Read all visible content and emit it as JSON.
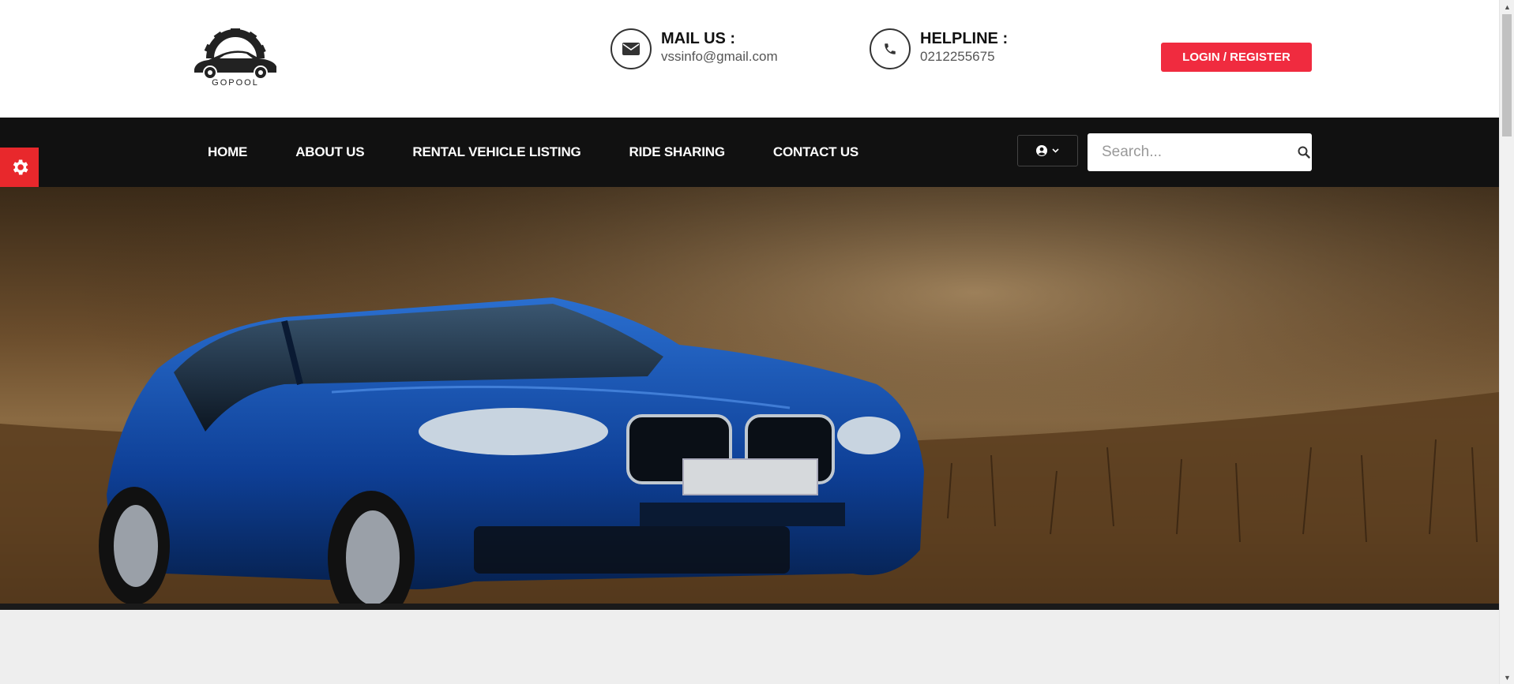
{
  "brand": {
    "logo_text": "GOPOOL",
    "accent_color": "#f02b3f",
    "nav_bg": "#111111"
  },
  "header": {
    "mail_label": "MAIL US :",
    "mail_value": "vssinfo@gmail.com",
    "helpline_label": "HELPLINE :",
    "helpline_value": "0212255675",
    "login_label": "LOGIN / REGISTER"
  },
  "nav": {
    "items": [
      {
        "label": "HOME"
      },
      {
        "label": "ABOUT US"
      },
      {
        "label": "RENTAL VEHICLE LISTING"
      },
      {
        "label": "RIDE SHARING"
      },
      {
        "label": "CONTACT US"
      }
    ],
    "search_placeholder": "Search..."
  },
  "icons": {
    "mail": "envelope-icon",
    "phone": "phone-icon",
    "user": "user-circle-icon",
    "search": "search-icon",
    "settings": "gear-icon"
  }
}
